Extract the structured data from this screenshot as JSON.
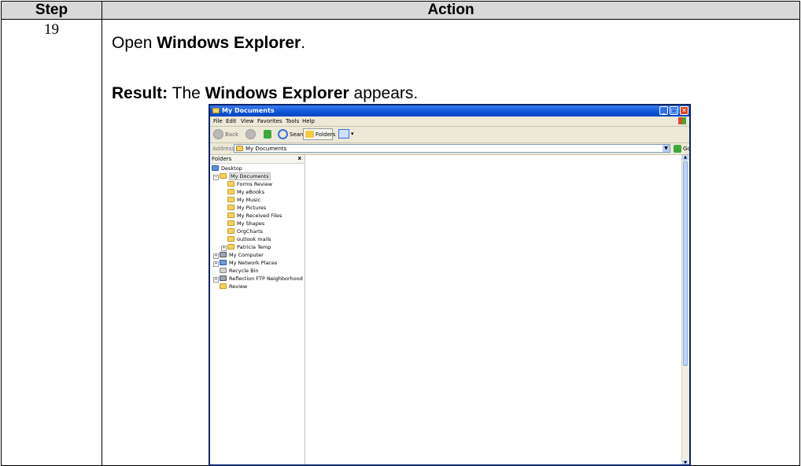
{
  "table": {
    "header_step": "Step",
    "header_action": "Action",
    "step_number": "19",
    "action_prefix": "Open ",
    "action_bold": "Windows Explorer",
    "action_suffix": ".",
    "result_label": "Result:",
    "result_prefix": " The ",
    "result_bold": "Windows Explorer",
    "result_suffix": " appears."
  },
  "explorer": {
    "title": "My Documents",
    "window_buttons": {
      "minimize": "_",
      "maximize": "□",
      "close": "✕"
    },
    "menu": [
      "File",
      "Edit",
      "View",
      "Favorites",
      "Tools",
      "Help"
    ],
    "toolbar": {
      "back": "Back",
      "search": "Search",
      "folders": "Folders",
      "views_arrow": "▾"
    },
    "address": {
      "label": "Address",
      "value": "My Documents",
      "go": "Go"
    },
    "folders_pane": {
      "header": "Folders",
      "close": "x",
      "items": [
        {
          "label": "Desktop",
          "icon": "desktop-icon"
        },
        {
          "label": "My Documents",
          "icon": "folder-icon"
        },
        {
          "label": "Forms Review",
          "icon": "folder-icon"
        },
        {
          "label": "My eBooks",
          "icon": "folder-icon"
        },
        {
          "label": "My Music",
          "icon": "music-folder-icon"
        },
        {
          "label": "My Pictures",
          "icon": "folder-icon"
        },
        {
          "label": "My Received Files",
          "icon": "folder-icon"
        },
        {
          "label": "My Shapes",
          "icon": "folder-icon"
        },
        {
          "label": "OrgCharts",
          "icon": "folder-icon"
        },
        {
          "label": "outlook mails",
          "icon": "folder-icon"
        },
        {
          "label": "Patricia Temp",
          "icon": "folder-icon"
        },
        {
          "label": "My Computer",
          "icon": "computer-icon"
        },
        {
          "label": "My Network Places",
          "icon": "network-icon"
        },
        {
          "label": "Recycle Bin",
          "icon": "recycle-bin-icon"
        },
        {
          "label": "Reflection FTP Neighborhood",
          "icon": "ftp-icon"
        },
        {
          "label": "Review",
          "icon": "folder-icon"
        }
      ]
    }
  }
}
